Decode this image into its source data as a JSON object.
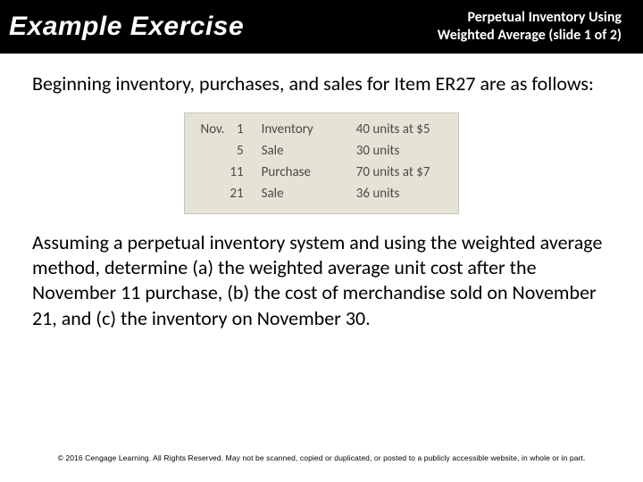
{
  "header": {
    "title": "Example Exercise",
    "subtitle_line1": "Perpetual Inventory Using",
    "subtitle_line2": "Weighted Average (slide 1 of 2)"
  },
  "intro": "Beginning inventory, purchases, and sales for Item ER27 are as follows:",
  "table": {
    "month": "Nov.",
    "rows": [
      {
        "day": "1",
        "event": "Inventory",
        "detail": "40 units at $5"
      },
      {
        "day": "5",
        "event": "Sale",
        "detail": "30 units"
      },
      {
        "day": "11",
        "event": "Purchase",
        "detail": "70 units at $7"
      },
      {
        "day": "21",
        "event": "Sale",
        "detail": "36 units"
      }
    ]
  },
  "question": "Assuming a perpetual inventory system and using the weighted average method, determine (a) the weighted average unit cost after the November 11 purchase, (b) the cost of merchandise sold on November 21, and (c) the inventory on November 30.",
  "footer": "© 2016 Cengage Learning. All Rights Reserved. May not be scanned, copied or duplicated, or posted to a publicly accessible website, in whole or in part."
}
